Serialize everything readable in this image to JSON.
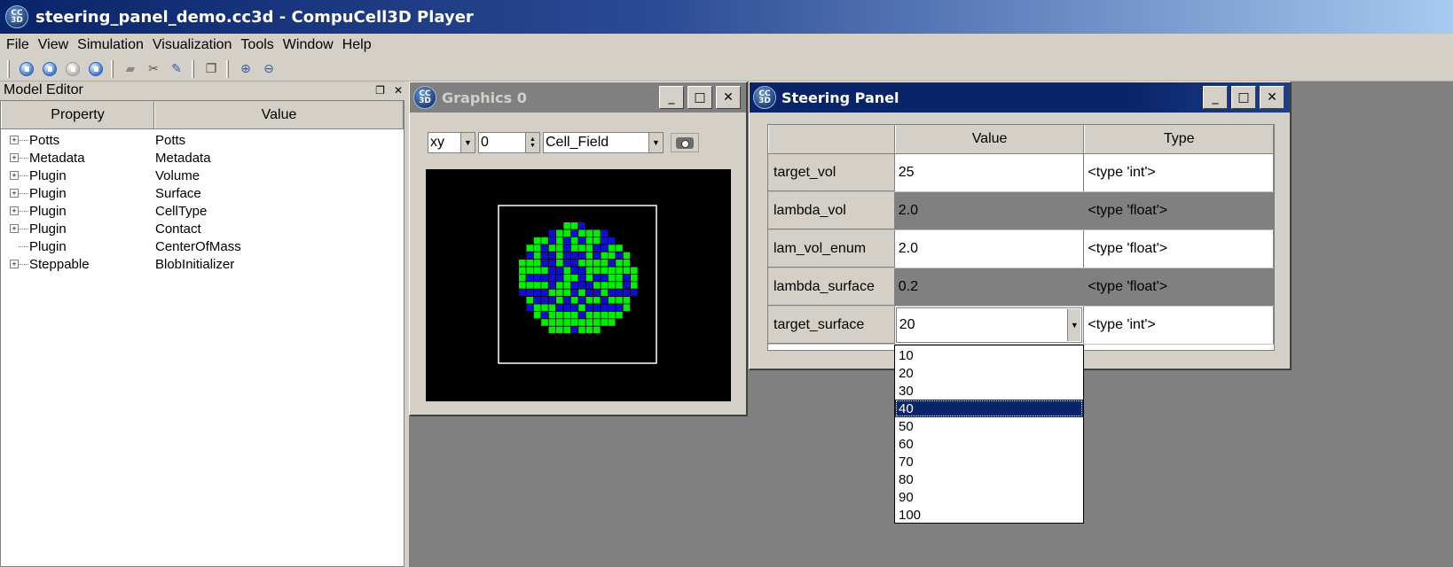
{
  "window": {
    "title": "steering_panel_demo.cc3d - CompuCell3D Player",
    "icon": "cc3d-logo-icon"
  },
  "menu": [
    "File",
    "View",
    "Simulation",
    "Visualization",
    "Tools",
    "Window",
    "Help"
  ],
  "toolbar": {
    "buttons": [
      "run-icon",
      "step-icon",
      "pause-icon",
      "stop-icon",
      "open-icon",
      "tools-icon",
      "edit-icon",
      "new-window-icon",
      "zoom-in-icon",
      "zoom-out-icon"
    ]
  },
  "model_editor": {
    "title": "Model Editor",
    "columns": [
      "Property",
      "Value"
    ],
    "rows": [
      {
        "property": "Potts",
        "value": "Potts",
        "expandable": true
      },
      {
        "property": "Metadata",
        "value": "Metadata",
        "expandable": true
      },
      {
        "property": "Plugin",
        "value": "Volume",
        "expandable": true
      },
      {
        "property": "Plugin",
        "value": "Surface",
        "expandable": true
      },
      {
        "property": "Plugin",
        "value": "CellType",
        "expandable": true
      },
      {
        "property": "Plugin",
        "value": "Contact",
        "expandable": true
      },
      {
        "property": "Plugin",
        "value": "CenterOfMass",
        "expandable": false
      },
      {
        "property": "Steppable",
        "value": "BlobInitializer",
        "expandable": true
      }
    ]
  },
  "graphics": {
    "title": "Graphics 0",
    "plane": "xy",
    "position": "0",
    "field": "Cell_Field",
    "colors": {
      "background": "#000000",
      "cell_a": "#00ee00",
      "cell_b": "#1010cc",
      "border": "#ffffff"
    }
  },
  "steering": {
    "title": "Steering Panel",
    "columns": [
      "",
      "Value",
      "Type"
    ],
    "rows": [
      {
        "name": "target_vol",
        "value": "25",
        "type": "<type 'int'>"
      },
      {
        "name": "lambda_vol",
        "value": "2.0",
        "type": "<type 'float'>"
      },
      {
        "name": "lam_vol_enum",
        "value": "2.0",
        "type": "<type 'float'>"
      },
      {
        "name": "lambda_surface",
        "value": "0.2",
        "type": "<type 'float'>"
      },
      {
        "name": "target_surface",
        "value": "20",
        "type": "<type 'int'>"
      }
    ],
    "dropdown_options": [
      "10",
      "20",
      "30",
      "40",
      "50",
      "60",
      "70",
      "80",
      "90",
      "100"
    ],
    "dropdown_highlighted": "40"
  },
  "colors": {
    "titlebar": "#0a246a",
    "mdi_background": "#808080",
    "chrome": "#d4d0c8",
    "selection": "#0a246a"
  }
}
